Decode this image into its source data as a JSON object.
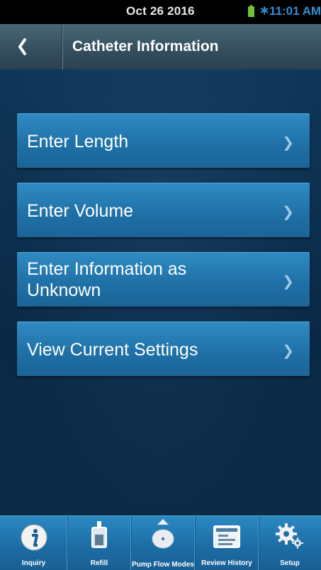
{
  "status_bar": {
    "date": "Oct 26 2016",
    "time": "11:01 AM",
    "icons": [
      "battery-charging-icon",
      "bluetooth-icon"
    ]
  },
  "header": {
    "back_icon": "chevron-left-icon",
    "title": "Catheter Information"
  },
  "menu": {
    "items": [
      {
        "label": "Enter Length",
        "icon": "chevron-right-icon"
      },
      {
        "label": "Enter Volume",
        "icon": "chevron-right-icon"
      },
      {
        "label": "Enter Information as Unknown",
        "icon": "chevron-right-icon"
      },
      {
        "label": "View Current Settings",
        "icon": "chevron-right-icon"
      }
    ]
  },
  "tab_bar": {
    "tabs": [
      {
        "label": "Inquiry",
        "icon": "info-icon"
      },
      {
        "label": "Refill",
        "icon": "refill-syringe-icon"
      },
      {
        "label": "Pump Flow Modes",
        "icon": "pump-icon"
      },
      {
        "label": "Review History",
        "icon": "history-screen-icon"
      },
      {
        "label": "Setup",
        "icon": "gears-icon"
      }
    ]
  },
  "colors": {
    "button_blue": "#1e6fa5",
    "background_navy": "#0b2a47",
    "status_time_blue": "#2f8fd6",
    "battery_green": "#6fc23a"
  }
}
